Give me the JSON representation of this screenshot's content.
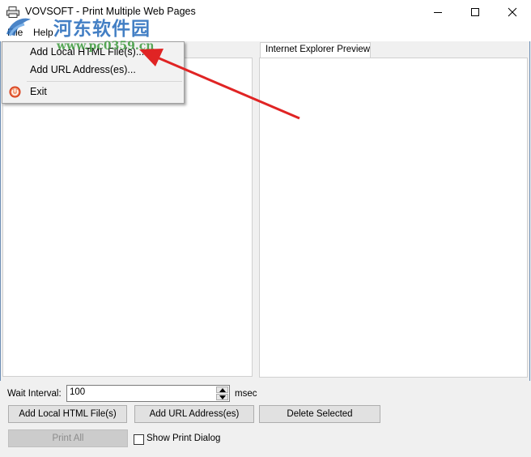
{
  "window": {
    "title": "VOVSOFT - Print Multiple Web Pages",
    "app_icon": "printer-icon",
    "controls": [
      "minimize-icon",
      "maximize-icon",
      "close-icon"
    ]
  },
  "menubar": {
    "file": "File",
    "help": "Help"
  },
  "file_menu": {
    "items": [
      {
        "label": "Add Local HTML File(s)...",
        "icon": ""
      },
      {
        "label": "Add URL Address(es)...",
        "icon": ""
      },
      {
        "label": "Exit",
        "icon": "exit-power-icon"
      }
    ]
  },
  "watermark": {
    "text": "河东软件园",
    "url": "www.pc0359.cn",
    "logo": "watermark-logo"
  },
  "preview_tab": {
    "label": "Internet Explorer Preview"
  },
  "wait": {
    "label": "Wait Interval:",
    "value": "100",
    "unit": "msec"
  },
  "buttons": {
    "add_local": "Add Local HTML File(s)",
    "add_url": "Add URL Address(es)",
    "delete_selected": "Delete Selected",
    "print_all": "Print All"
  },
  "show_print_dialog": {
    "label": "Show Print Dialog",
    "checked": false
  },
  "colors": {
    "annotation_arrow": "#e02424",
    "watermark_blue": "#2a6ebd",
    "watermark_green": "#3c9a3c"
  }
}
